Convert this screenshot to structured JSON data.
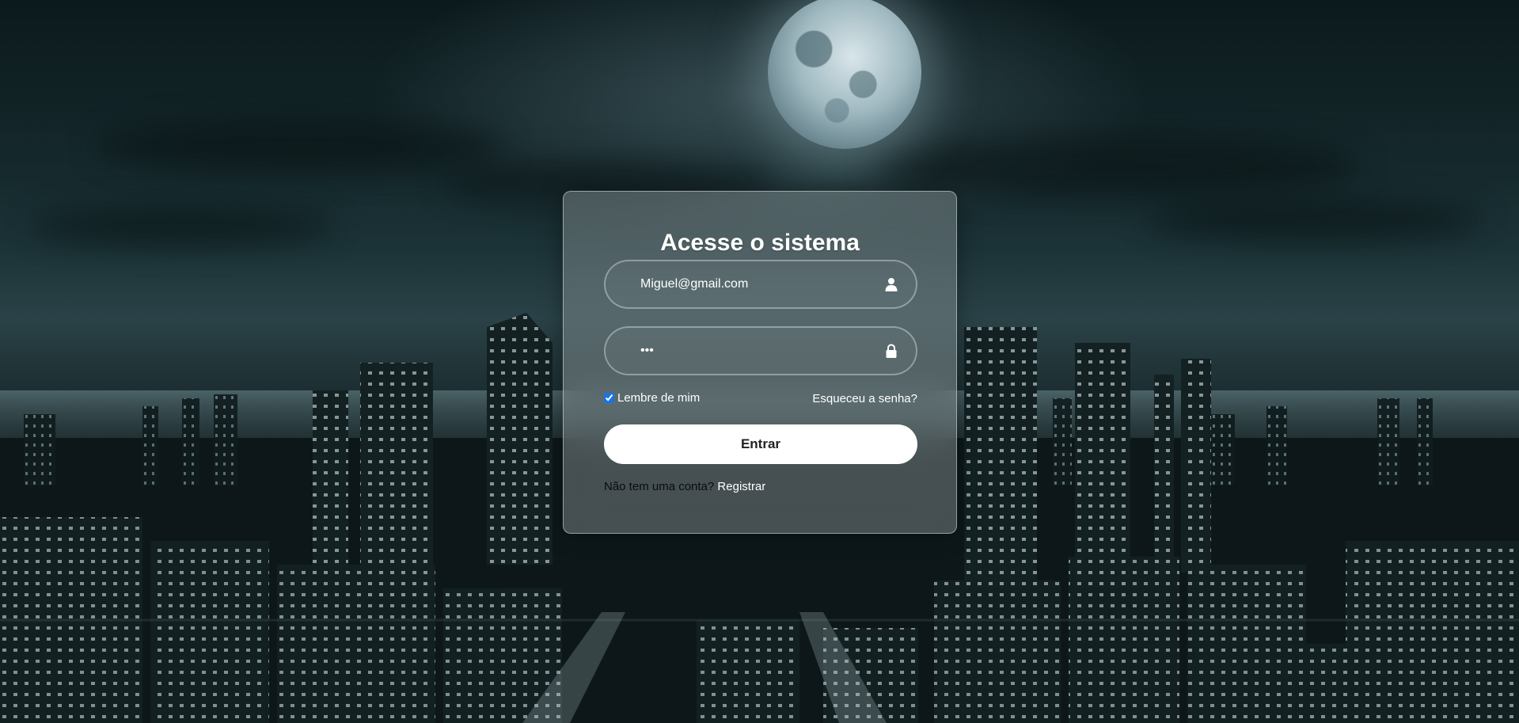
{
  "login": {
    "title": "Acesse o sistema",
    "email_value": "Miguel@gmail.com",
    "email_icon": "user-icon",
    "password_value": "•••",
    "password_icon": "lock-icon",
    "remember_label": "Lembre de mim",
    "remember_checked": true,
    "forgot_label": "Esqueceu a senha?",
    "submit_label": "Entrar",
    "register_prompt": "Não tem uma conta?",
    "register_link": "Registrar"
  },
  "colors": {
    "button_bg": "#ffffff",
    "button_text": "#222222",
    "checkbox_accent": "#1a73e8"
  }
}
